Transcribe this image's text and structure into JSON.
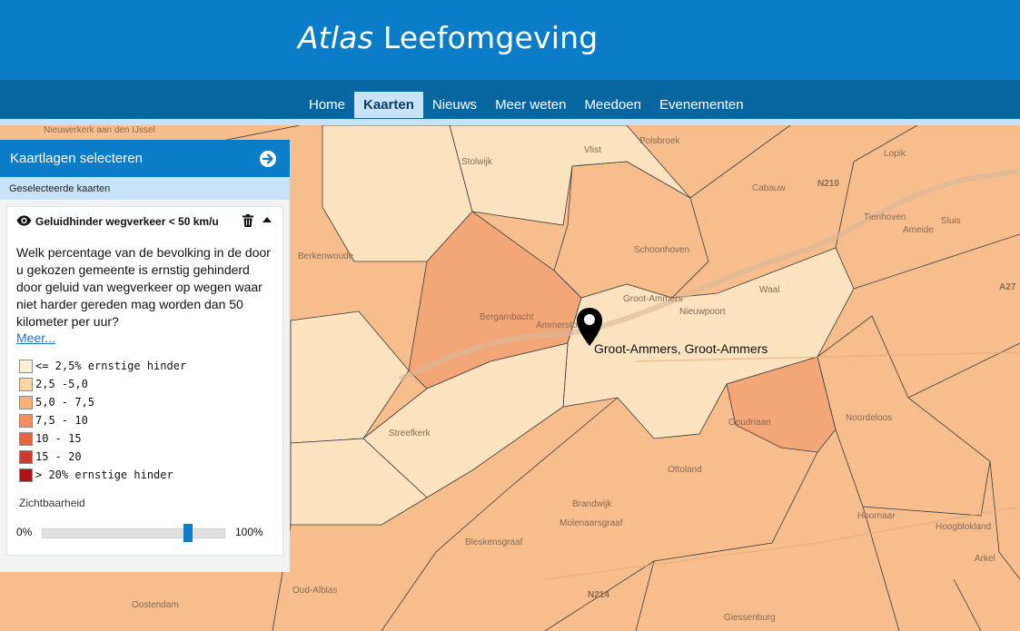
{
  "header": {
    "brand_italic": "Atlas",
    "brand_rest": "Leefomgeving"
  },
  "nav": {
    "items": [
      {
        "label": "Home",
        "active": false
      },
      {
        "label": "Kaarten",
        "active": true
      },
      {
        "label": "Nieuws",
        "active": false
      },
      {
        "label": "Meer weten",
        "active": false
      },
      {
        "label": "Meedoen",
        "active": false
      },
      {
        "label": "Evenementen",
        "active": false
      }
    ]
  },
  "panel": {
    "title": "Kaartlagen selecteren",
    "subtitle": "Geselecteerde kaarten",
    "layer": {
      "name": "Geluidhinder wegverkeer < 50 km/u",
      "description": "Welk percentage van de bevolking in de door u gekozen gemeente is ernstig gehinderd door geluid van wegverkeer op wegen waar niet harder gereden mag worden dan 50 kilometer per uur?",
      "more_link": "Meer...",
      "legend": [
        {
          "label": "<= 2,5% ernstige hinder",
          "color": "#fdf0d5"
        },
        {
          "label": " 2,5 -5,0",
          "color": "#fdd4a3"
        },
        {
          "label": "5,0 - 7,5",
          "color": "#fcae7b"
        },
        {
          "label": "7,5 - 10",
          "color": "#f78d60"
        },
        {
          "label": "10 - 15",
          "color": "#e8633f"
        },
        {
          "label": "15 - 20",
          "color": "#cf3a2e"
        },
        {
          "label": "> 20% ernstige hinder",
          "color": "#b11218"
        }
      ],
      "visibility_label": "Zichtbaarheid",
      "slider_min_label": "0%",
      "slider_max_label": "100%",
      "opacity": 0.8
    }
  },
  "map": {
    "marker_label": "Groot-Ammers, Groot-Ammers",
    "places": [
      "Nieuwerkerk aan den IJssel",
      "Stolwijk",
      "Vlist",
      "Polsbroek",
      "Lopik",
      "Cabauw",
      "Berkenwoude",
      "Schoonhoven",
      "Tienhoven",
      "Ameide",
      "Sluis",
      "Groot-Ammers",
      "Waal",
      "Nieuwpoort",
      "Bergambacht",
      "Ammerstol",
      "Streefkerk",
      "Goudriaan",
      "Noordeloos",
      "Ottoland",
      "Brandwijk",
      "Molenaarsgraaf",
      "Bleskensgraaf",
      "Hoornaar",
      "Hoogblokland",
      "Arkel",
      "Oostendam",
      "Oud-Alblas",
      "Giessenburg"
    ],
    "roads": [
      "N210",
      "N214",
      "A27"
    ],
    "colors": {
      "light": "#fbe3bf",
      "medium": "#f8be8e",
      "darker": "#f2a77a"
    }
  }
}
